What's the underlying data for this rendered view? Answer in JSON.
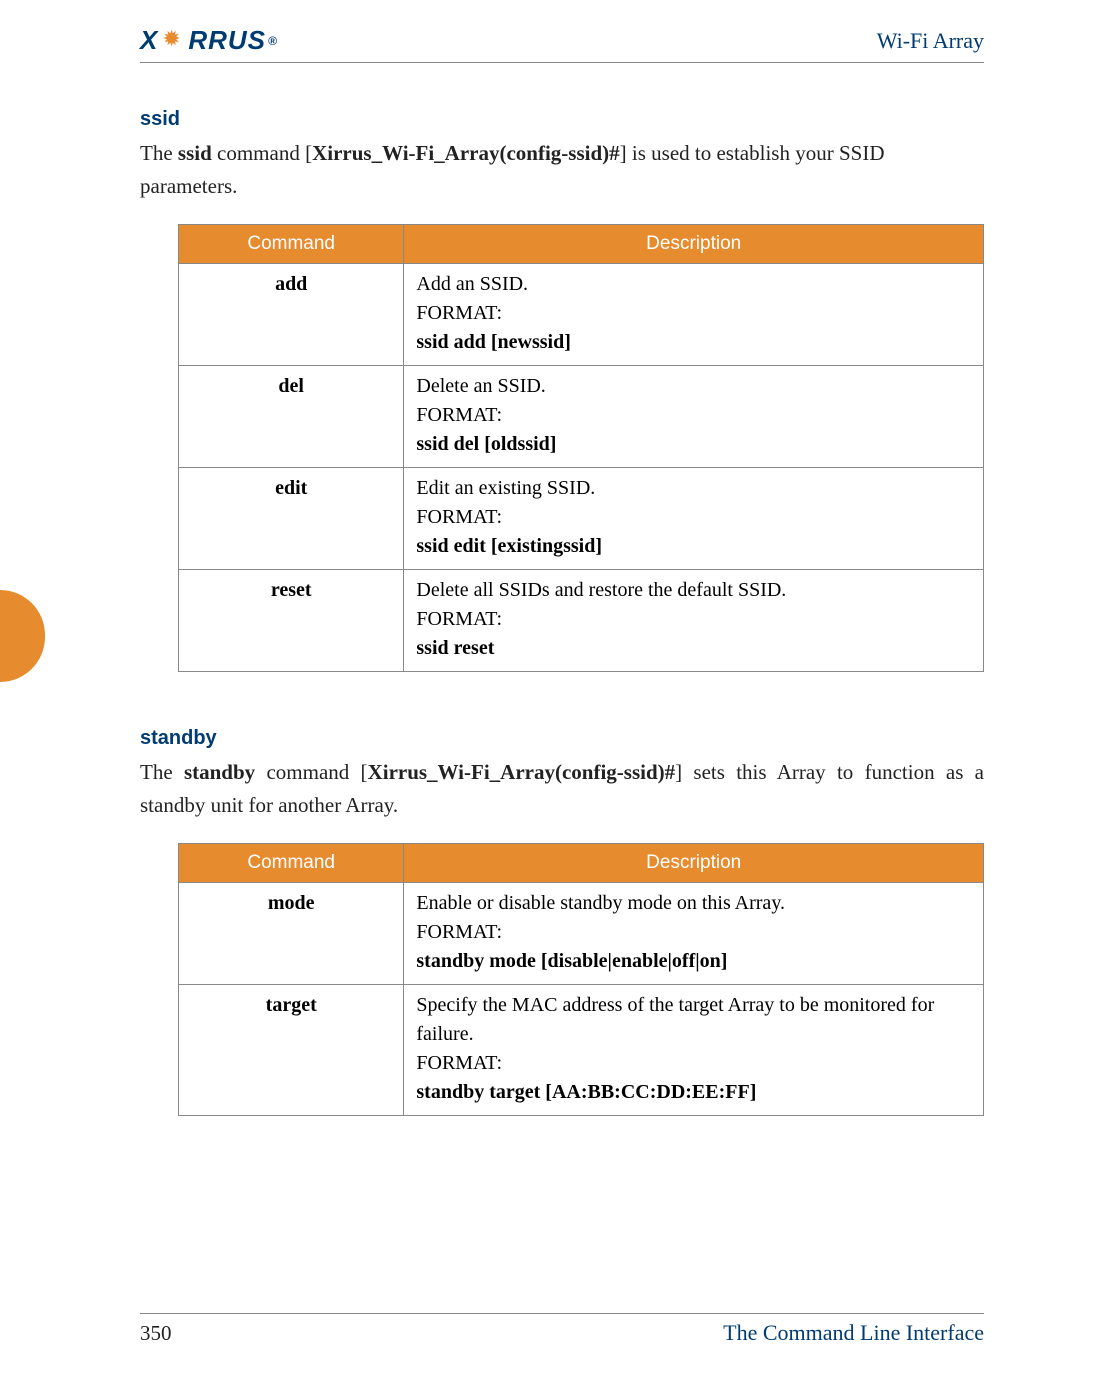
{
  "header": {
    "logo_prefix": "X",
    "logo_suffix": "RRUS",
    "logo_reg": "®",
    "title": "Wi-Fi Array"
  },
  "sections": [
    {
      "heading": "ssid",
      "intro_parts": [
        "The ",
        "ssid",
        " command [",
        "Xirrus_Wi-Fi_Array(config-ssid)#",
        "] is used to establish your SSID parameters."
      ],
      "justify": false,
      "table": {
        "headers": [
          "Command",
          "Description"
        ],
        "rows": [
          {
            "cmd": "add",
            "desc": "Add an SSID.",
            "format_label": "FORMAT:",
            "format_value": "ssid add [newssid]"
          },
          {
            "cmd": "del",
            "desc": "Delete an SSID.",
            "format_label": "FORMAT:",
            "format_value": "ssid del [oldssid]"
          },
          {
            "cmd": "edit",
            "desc": "Edit an existing SSID.",
            "format_label": "FORMAT:",
            "format_value": "ssid edit [existingssid]"
          },
          {
            "cmd": "reset",
            "desc": "Delete all SSIDs and restore the default SSID.",
            "format_label": "FORMAT:",
            "format_value": "ssid reset"
          }
        ]
      }
    },
    {
      "heading": "standby",
      "intro_parts": [
        "The ",
        "standby",
        " command [",
        "Xirrus_Wi-Fi_Array(config-ssid)#",
        "] sets this Array to function as a standby unit for another Array."
      ],
      "justify": true,
      "table": {
        "headers": [
          "Command",
          "Description"
        ],
        "rows": [
          {
            "cmd": "mode",
            "desc": "Enable or disable standby mode on this Array.",
            "format_label": "FORMAT:",
            "format_value": "standby mode [disable|enable|off|on]"
          },
          {
            "cmd": "target",
            "desc": "Specify the MAC address of the target Array to be monitored for failure.",
            "format_label": "FORMAT:",
            "format_value": "standby target [AA:BB:CC:DD:EE:FF]"
          }
        ]
      }
    }
  ],
  "footer": {
    "page_number": "350",
    "title": "The Command Line Interface"
  }
}
